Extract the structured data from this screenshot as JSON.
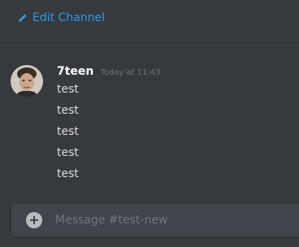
{
  "header": {
    "edit_channel_label": "Edit Channel",
    "edit_icon": "pencil-icon",
    "accent_color": "#2c9ce6"
  },
  "message_group": {
    "username": "7teen",
    "timestamp": "Today at 11:43",
    "messages": [
      "test",
      "test",
      "test",
      "test",
      "test"
    ]
  },
  "composer": {
    "placeholder": "Message #test-new",
    "upload_icon": "plus-circle-icon"
  },
  "colors": {
    "background": "#36393e",
    "input_background": "#40444b",
    "username": "#ffffff",
    "timestamp": "#6e7278",
    "message_text": "#dcddde"
  }
}
